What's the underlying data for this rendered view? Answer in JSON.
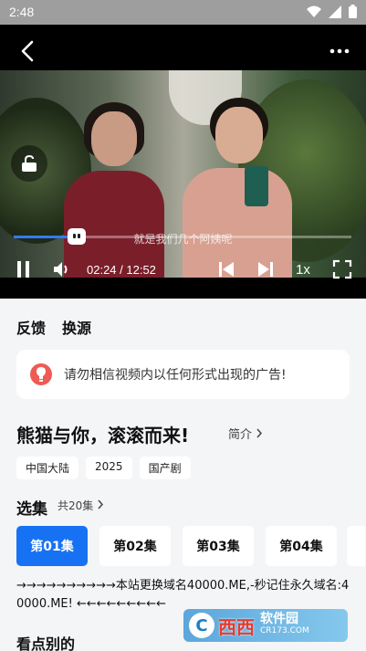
{
  "status_bar": {
    "time": "2:48",
    "icons": [
      "wifi-icon",
      "signal-icon",
      "battery-icon"
    ]
  },
  "player": {
    "subtitle": "就是我们几个阿姨呢",
    "current_time": "02:24",
    "duration": "12:52",
    "time_separator": " / ",
    "time_display": "02:24 / 12:52",
    "progress_fraction": 0.187,
    "speed": "1x",
    "accent_color": "#2f7bf6",
    "icons": [
      "back-icon",
      "more-icon",
      "unlock-icon",
      "pause-icon",
      "volume-icon",
      "skip-previous-icon",
      "skip-next-icon",
      "fullscreen-icon"
    ]
  },
  "tabs": [
    "反馈",
    "换源"
  ],
  "notice": {
    "text": "请勿相信视频内以任何形式出现的广告!",
    "icon": "lightbulb-icon",
    "icon_color": "#ef5a55"
  },
  "show": {
    "title": "熊猫与你，滚滚而来!",
    "intro_label": "简介",
    "tags": [
      "中国大陆",
      "2025",
      "国产剧"
    ]
  },
  "episodes": {
    "header": "选集",
    "count_label": "共20集",
    "items": [
      {
        "label": "第01集",
        "active": true
      },
      {
        "label": "第02集",
        "active": false
      },
      {
        "label": "第03集",
        "active": false
      },
      {
        "label": "第04集",
        "active": false
      }
    ],
    "active_color": "#1672f3"
  },
  "marquee_text": "→→→→→→→→→→本站更换域名40000.ME,-秒记住永久域名:40000.ME! ←←←←←←←←←",
  "section_title": "看点别的",
  "watermark": {
    "logo": "C",
    "brand": "西西",
    "name": "软件园",
    "domain": "CR173.COM"
  }
}
